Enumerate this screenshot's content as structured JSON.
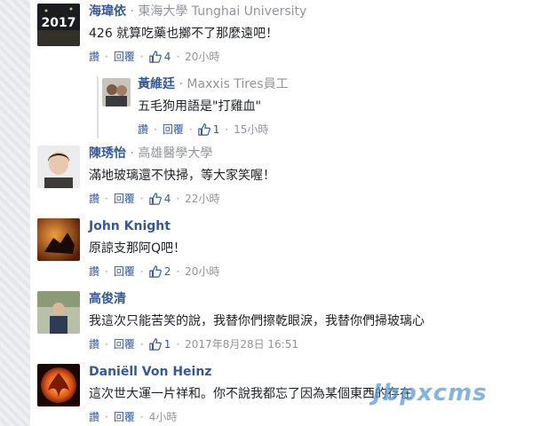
{
  "comments": [
    {
      "author": "海瑋依",
      "employer": "東海大學 Tunghai University",
      "text": "426 就算吃藥也擲不了那麼遠吧！",
      "actions": {
        "like": "讚",
        "reply": "回覆",
        "likes": "4",
        "time": "20小時"
      },
      "avatar_text": "2017"
    },
    {
      "author": "黃維廷",
      "employer": "Maxxis Tires員工",
      "text": "五毛狗用語是\"打雞血\"",
      "actions": {
        "like": "讚",
        "reply": "回覆",
        "likes": "1",
        "time": "15小時"
      }
    },
    {
      "author": "陳琇怡",
      "employer": "高雄醫學大學",
      "text": "滿地玻璃還不快掃，等大家笑喔！",
      "actions": {
        "like": "讚",
        "reply": "回覆",
        "likes": "4",
        "time": "22小時"
      }
    },
    {
      "author": "John Knight",
      "employer": "",
      "text": "原諒支那阿Q吧！",
      "actions": {
        "like": "讚",
        "reply": "回覆",
        "likes": "2",
        "time": "20小時"
      }
    },
    {
      "author": "高俊清",
      "employer": "",
      "text": "我這次只能苦笑的說，我替你們擦乾眼淚，我替你們掃玻璃心",
      "actions": {
        "like": "讚",
        "reply": "回覆",
        "likes": "1",
        "time": "2017年8月28日 16:51"
      }
    },
    {
      "author": "Daniëll Von Heinz",
      "employer": "",
      "text": "這次世大運一片祥和。你不說我都忘了因為某個東西的存在",
      "actions": {
        "like": "讚",
        "reply": "回覆",
        "likes": "",
        "time": "4小時"
      }
    }
  ],
  "separator": "·",
  "watermark": "Jbpxcms",
  "colors": {
    "link": "#365899",
    "meta": "#90949c"
  }
}
